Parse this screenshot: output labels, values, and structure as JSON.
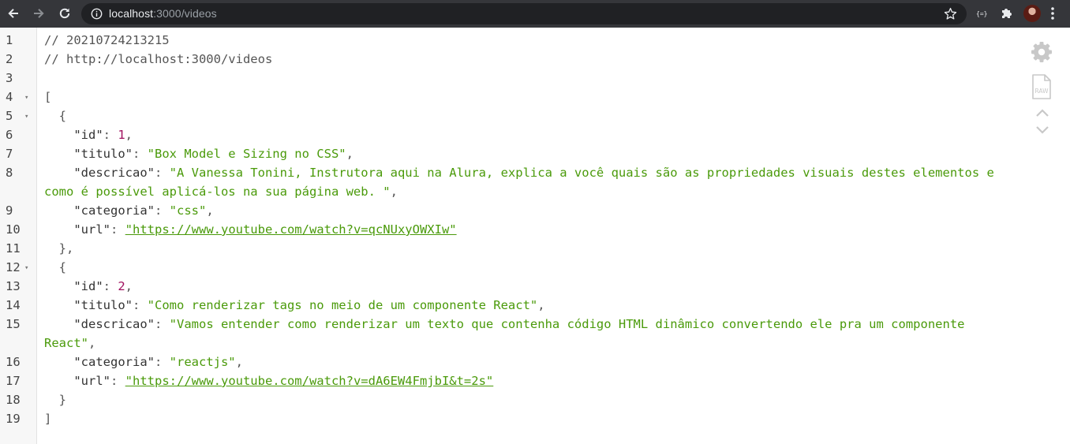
{
  "browser": {
    "url_host": "localhost",
    "url_rest": ":3000/videos"
  },
  "icons": {
    "back": "arrow-left-icon",
    "forward": "arrow-right-icon",
    "reload": "reload-icon",
    "info": "info-icon",
    "bookmark": "star-icon",
    "json_ext": "json-extension-icon",
    "extensions": "puzzle-icon",
    "menu": "kebab-menu-icon",
    "settings": "gear-icon",
    "raw": "raw-file-icon",
    "collapse": "collapse-arrows-icon"
  },
  "viewer": {
    "raw_label": "RAW",
    "lines": [
      {
        "n": "1",
        "fold": "",
        "t": [
          {
            "c": "comment",
            "v": "// 20210724213215"
          }
        ]
      },
      {
        "n": "2",
        "fold": "",
        "t": [
          {
            "c": "comment",
            "v": "// http://localhost:3000/videos"
          }
        ]
      },
      {
        "n": "3",
        "fold": "",
        "t": []
      },
      {
        "n": "4",
        "fold": "▾",
        "t": [
          {
            "c": "punct",
            "v": "["
          }
        ]
      },
      {
        "n": "5",
        "fold": "▾",
        "t": [
          {
            "c": "punct",
            "v": "  {"
          }
        ]
      },
      {
        "n": "6",
        "fold": "",
        "t": [
          {
            "c": "key",
            "v": "    \"id\""
          },
          {
            "c": "punct",
            "v": ": "
          },
          {
            "c": "num",
            "v": "1"
          },
          {
            "c": "punct",
            "v": ","
          }
        ]
      },
      {
        "n": "7",
        "fold": "",
        "t": [
          {
            "c": "key",
            "v": "    \"titulo\""
          },
          {
            "c": "punct",
            "v": ": "
          },
          {
            "c": "str",
            "v": "\"Box Model e Sizing no CSS\""
          },
          {
            "c": "punct",
            "v": ","
          }
        ]
      },
      {
        "n": "8",
        "fold": "",
        "wrap": true,
        "t": [
          {
            "c": "key",
            "v": "    \"descricao\""
          },
          {
            "c": "punct",
            "v": ": "
          },
          {
            "c": "str",
            "v": "\"A Vanessa Tonini, Instrutora aqui na Alura, explica a você quais são as propriedades visuais destes elementos e como é possível aplicá-los na sua página web. \""
          },
          {
            "c": "punct",
            "v": ","
          }
        ]
      },
      {
        "n": "9",
        "fold": "",
        "t": [
          {
            "c": "key",
            "v": "    \"categoria\""
          },
          {
            "c": "punct",
            "v": ": "
          },
          {
            "c": "str",
            "v": "\"css\""
          },
          {
            "c": "punct",
            "v": ","
          }
        ]
      },
      {
        "n": "10",
        "fold": "",
        "t": [
          {
            "c": "key",
            "v": "    \"url\""
          },
          {
            "c": "punct",
            "v": ": "
          },
          {
            "c": "link",
            "v": "\"https://www.youtube.com/watch?v=qcNUxyOWXIw\""
          }
        ]
      },
      {
        "n": "11",
        "fold": "",
        "t": [
          {
            "c": "punct",
            "v": "  },"
          }
        ]
      },
      {
        "n": "12",
        "fold": "▾",
        "t": [
          {
            "c": "punct",
            "v": "  {"
          }
        ]
      },
      {
        "n": "13",
        "fold": "",
        "t": [
          {
            "c": "key",
            "v": "    \"id\""
          },
          {
            "c": "punct",
            "v": ": "
          },
          {
            "c": "num",
            "v": "2"
          },
          {
            "c": "punct",
            "v": ","
          }
        ]
      },
      {
        "n": "14",
        "fold": "",
        "t": [
          {
            "c": "key",
            "v": "    \"titulo\""
          },
          {
            "c": "punct",
            "v": ": "
          },
          {
            "c": "str",
            "v": "\"Como renderizar tags no meio de um componente React\""
          },
          {
            "c": "punct",
            "v": ","
          }
        ]
      },
      {
        "n": "15",
        "fold": "",
        "wrap": true,
        "t": [
          {
            "c": "key",
            "v": "    \"descricao\""
          },
          {
            "c": "punct",
            "v": ": "
          },
          {
            "c": "str",
            "v": "\"Vamos entender como renderizar um texto que contenha código HTML dinâmico convertendo ele pra um componente React\""
          },
          {
            "c": "punct",
            "v": ","
          }
        ]
      },
      {
        "n": "16",
        "fold": "",
        "t": [
          {
            "c": "key",
            "v": "    \"categoria\""
          },
          {
            "c": "punct",
            "v": ": "
          },
          {
            "c": "str",
            "v": "\"reactjs\""
          },
          {
            "c": "punct",
            "v": ","
          }
        ]
      },
      {
        "n": "17",
        "fold": "",
        "t": [
          {
            "c": "key",
            "v": "    \"url\""
          },
          {
            "c": "punct",
            "v": ": "
          },
          {
            "c": "link",
            "v": "\"https://www.youtube.com/watch?v=dA6EW4FmjbI&t=2s\""
          }
        ]
      },
      {
        "n": "18",
        "fold": "",
        "t": [
          {
            "c": "punct",
            "v": "  }"
          }
        ]
      },
      {
        "n": "19",
        "fold": "",
        "t": [
          {
            "c": "punct",
            "v": "]"
          }
        ]
      }
    ]
  }
}
